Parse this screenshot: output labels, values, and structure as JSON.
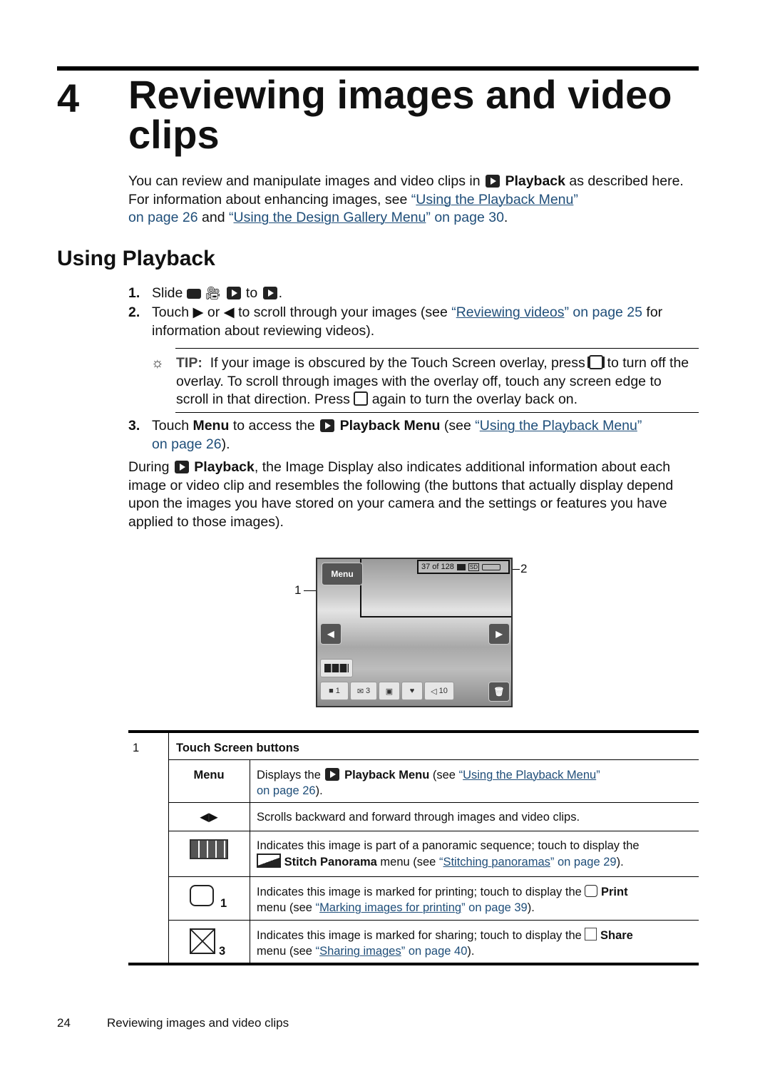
{
  "chapter": {
    "number": "4",
    "title": "Reviewing images and video clips"
  },
  "intro": {
    "t1": "You can review and manipulate images and video clips in",
    "bold1": "Playback",
    "t2": "as described here. For information about enhancing images, see",
    "link1": "Using the Playback Menu",
    "link1_page": "on page 26",
    "t3": "and",
    "link2": "Using the Design Gallery Menu",
    "link2_page": "on page 30",
    "t4": "."
  },
  "section": {
    "title": "Using Playback"
  },
  "steps": [
    {
      "num": "1.",
      "text_a": "Slide",
      "text_b": "to",
      "text_c": "."
    },
    {
      "num": "2.",
      "text_a": "Touch",
      "text_b": "or",
      "text_c": "to scroll through your images (see",
      "link": "Reviewing videos",
      "link_page": "on page 25",
      "text_d": "for information about reviewing videos)."
    },
    {
      "num": "3.",
      "text_a": "Touch",
      "bold_a": "Menu",
      "text_b": "to access the",
      "bold_b": "Playback Menu",
      "text_c": "(see",
      "link": "Using the Playback Menu",
      "link_page": "on page 26",
      "text_d": ")."
    }
  ],
  "tip": {
    "label": "TIP:",
    "t1": "If your image is obscured by the Touch Screen overlay, press",
    "t2": "to turn off the overlay. To scroll through images with the overlay off, touch any screen edge to scroll in that direction. Press",
    "t3": "again to turn the overlay back on."
  },
  "during": {
    "t1": "During",
    "bold": "Playback",
    "t2": ", the Image Display also indicates additional information about each image or video clip and resembles the following (the buttons that actually display depend upon the images you have stored on your camera and the settings or features you have applied to those images)."
  },
  "figure": {
    "callout1": "1",
    "callout2": "2",
    "menu_button": "Menu",
    "counter": "37 of 128",
    "sd_badge": "SD",
    "print_count": "1",
    "share_count": "3",
    "tag_count": "10"
  },
  "table": {
    "row_num": "1",
    "header": "Touch Screen buttons",
    "rows": [
      {
        "key": "Menu",
        "t1": "Displays the",
        "bold": "Playback Menu",
        "t2": "(see",
        "link": "Using the Playback Menu",
        "link_page": "on page 26",
        "t3": ")."
      },
      {
        "key_icon": "arrows",
        "t1": "Scrolls backward and forward through images and video clips."
      },
      {
        "key_icon": "panorama",
        "t1": "Indicates this image is part of a panoramic sequence; touch to display the",
        "bold": "Stitch Panorama",
        "t2": "menu (see",
        "link": "Stitching panoramas",
        "link_page": "on page 29",
        "t3": ")."
      },
      {
        "key_icon": "print",
        "key_count": "1",
        "t1": "Indicates this image is marked for printing; touch to display the",
        "bold": "Print",
        "t2": "menu (see",
        "link": "Marking images for printing",
        "link_page": "on page 39",
        "t3": ")."
      },
      {
        "key_icon": "share",
        "key_count": "3",
        "t1": "Indicates this image is marked for sharing; touch to display the",
        "bold": "Share",
        "t2": "menu (see",
        "link": "Sharing images",
        "link_page": "on page 40",
        "t3": ")."
      }
    ]
  },
  "footer": {
    "page_number": "24",
    "chapter_title": "Reviewing images and video clips"
  }
}
